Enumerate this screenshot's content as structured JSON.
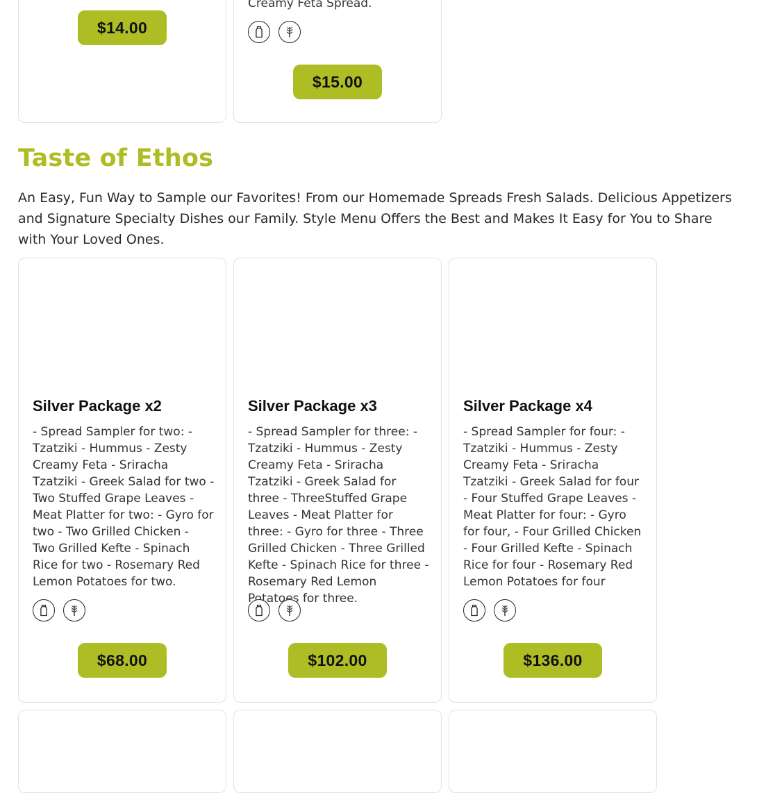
{
  "top_row": {
    "card1": {
      "price": "$14.00"
    },
    "card2": {
      "desc_fragment": "Creamy Feta Spread.",
      "icons": [
        "milk-bottle-icon",
        "wheat-icon"
      ],
      "price": "$15.00"
    }
  },
  "section": {
    "title": "Taste of Ethos",
    "description": "An Easy, Fun Way to Sample our Favorites! From our Homemade Spreads Fresh Salads. Delicious Appetizers and Signature Specialty Dishes our Family. Style Menu Offers the Best and Makes It Easy for You to Share with Your Loved Ones."
  },
  "packages": [
    {
      "name": "Silver Package x2",
      "description": "- Spread Sampler for two: - Tzatziki - Hummus - Zesty Creamy Feta - Sriracha Tzatziki - Greek Salad for two - Two Stuffed Grape Leaves - Meat Platter for two: - Gyro for two - Two Grilled Chicken - Two Grilled Kefte - Spinach Rice for two - Rosemary Red Lemon Potatoes for two.",
      "icons": [
        "milk-bottle-icon",
        "wheat-icon"
      ],
      "price": "$68.00"
    },
    {
      "name": "Silver Package x3",
      "description": "- Spread Sampler for three: - Tzatziki - Hummus - Zesty Creamy Feta - Sriracha Tzatziki - Greek Salad for three - ThreeStuffed Grape Leaves - Meat Platter for three: - Gyro for three - Three Grilled Chicken - Three Grilled Kefte - Spinach Rice for three - Rosemary Red Lemon Potatoes for three.",
      "icons": [
        "milk-bottle-icon",
        "wheat-icon"
      ],
      "price": "$102.00"
    },
    {
      "name": "Silver Package x4",
      "description": "- Spread Sampler for four: - Tzatziki - Hummus - Zesty Creamy Feta - Sriracha Tzatziki - Greek Salad for four - Four Stuffed Grape Leaves - Meat Platter for four: - Gyro for four, - Four Grilled Chicken - Four Grilled Kefte - Spinach Rice for four - Rosemary Red Lemon Potatoes for four",
      "icons": [
        "milk-bottle-icon",
        "wheat-icon"
      ],
      "price": "$136.00"
    }
  ],
  "colors": {
    "accent": "#adbd23",
    "card_border": "#e2e2e2",
    "text": "#333333"
  }
}
